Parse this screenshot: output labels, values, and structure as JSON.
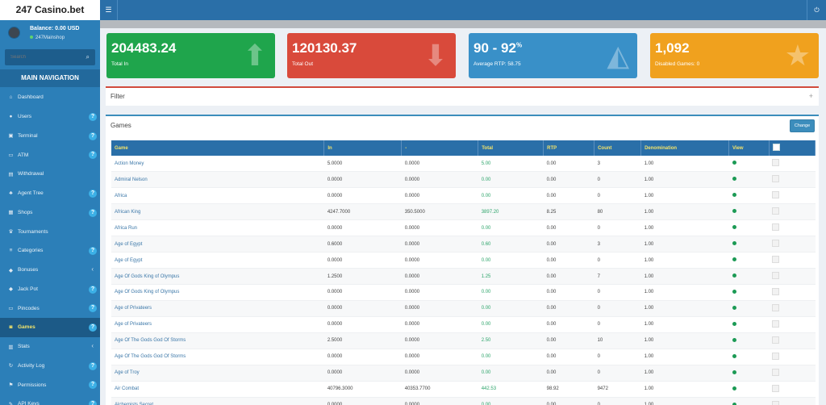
{
  "app": {
    "title": "247 Casino.bet"
  },
  "user": {
    "balance": "Balance: 0.00 USD",
    "shop": "247Mainshop"
  },
  "search": {
    "placeholder": "Search"
  },
  "nav": {
    "heading": "MAIN NAVIGATION",
    "items": [
      {
        "label": "Dashboard",
        "icon": "home-icon",
        "glyph": "⌂",
        "badge": ""
      },
      {
        "label": "Users",
        "icon": "user-icon",
        "glyph": "●",
        "badge": "?"
      },
      {
        "label": "Terminal",
        "icon": "terminal-icon",
        "glyph": "▣",
        "badge": "?"
      },
      {
        "label": "ATM",
        "icon": "credit-card-icon",
        "glyph": "▭",
        "badge": "?"
      },
      {
        "label": "Withdrawal",
        "icon": "money-icon",
        "glyph": "▤",
        "badge": ""
      },
      {
        "label": "Agent Tree",
        "icon": "sitemap-icon",
        "glyph": "♣",
        "badge": "?"
      },
      {
        "label": "Shops",
        "icon": "shop-icon",
        "glyph": "▦",
        "badge": "?"
      },
      {
        "label": "Tournaments",
        "icon": "trophy-icon",
        "glyph": "♛",
        "badge": ""
      },
      {
        "label": "Categories",
        "icon": "list-icon",
        "glyph": "≡",
        "badge": "?"
      },
      {
        "label": "Bonuses",
        "icon": "diamond-icon",
        "glyph": "◆",
        "badge": "‹"
      },
      {
        "label": "Jack Pot",
        "icon": "diamond-icon",
        "glyph": "◆",
        "badge": "?"
      },
      {
        "label": "Pincodes",
        "icon": "key-icon",
        "glyph": "▭",
        "badge": "?"
      },
      {
        "label": "Games",
        "icon": "gamepad-icon",
        "glyph": "◙",
        "badge": "?"
      },
      {
        "label": "Stats",
        "icon": "chart-icon",
        "glyph": "▥",
        "badge": "‹"
      },
      {
        "label": "Activity Log",
        "icon": "history-icon",
        "glyph": "↻",
        "badge": "?"
      },
      {
        "label": "Permissions",
        "icon": "shield-icon",
        "glyph": "⚑",
        "badge": "?"
      },
      {
        "label": "API Keys",
        "icon": "key-icon",
        "glyph": "✎",
        "badge": "?"
      }
    ]
  },
  "stats": [
    {
      "value": "204483.24",
      "label": "Total In",
      "icon": "arrow-up-icon",
      "glyph": "⬆"
    },
    {
      "value": "120130.37",
      "label": "Total Out",
      "icon": "arrow-down-icon",
      "glyph": "⬇"
    },
    {
      "value": "90 - 92",
      "suffix": "%",
      "label": "Average RTP: 58.75",
      "icon": "area-chart-icon",
      "glyph": "◭"
    },
    {
      "value": "1,092",
      "label": "Disabled Games: 0",
      "icon": "star-icon",
      "glyph": "★"
    }
  ],
  "filter": {
    "title": "Filter",
    "toggle": "+"
  },
  "games": {
    "title": "Games",
    "change_label": "Change",
    "columns": [
      "Game",
      "In",
      "-",
      "Total",
      "RTP",
      "Count",
      "Denomination",
      "View"
    ],
    "rows": [
      [
        "Action Money",
        "5.0000",
        "0.0000",
        "5.00",
        "0.00",
        "3",
        "1.00"
      ],
      [
        "Admiral Nelson",
        "0.0000",
        "0.0000",
        "0.00",
        "0.00",
        "0",
        "1.00"
      ],
      [
        "Africa",
        "0.0000",
        "0.0000",
        "0.00",
        "0.00",
        "0",
        "1.00"
      ],
      [
        "African King",
        "4247.7000",
        "350.5000",
        "3897.20",
        "8.25",
        "80",
        "1.00"
      ],
      [
        "Africa Run",
        "0.0000",
        "0.0000",
        "0.00",
        "0.00",
        "0",
        "1.00"
      ],
      [
        "Age of Egypt",
        "0.6000",
        "0.0000",
        "0.60",
        "0.00",
        "3",
        "1.00"
      ],
      [
        "Age of Egypt",
        "0.0000",
        "0.0000",
        "0.00",
        "0.00",
        "0",
        "1.00"
      ],
      [
        "Age Of Gods King of Olympus",
        "1.2500",
        "0.0000",
        "1.25",
        "0.00",
        "7",
        "1.00"
      ],
      [
        "Age Of Gods King of Olympus",
        "0.0000",
        "0.0000",
        "0.00",
        "0.00",
        "0",
        "1.00"
      ],
      [
        "Age of Privateers",
        "0.0000",
        "0.0000",
        "0.00",
        "0.00",
        "0",
        "1.00"
      ],
      [
        "Age of Privateers",
        "0.0000",
        "0.0000",
        "0.00",
        "0.00",
        "0",
        "1.00"
      ],
      [
        "Age Of The Gods God Of Storms",
        "2.5000",
        "0.0000",
        "2.50",
        "0.00",
        "10",
        "1.00"
      ],
      [
        "Age Of The Gods God Of Storms",
        "0.0000",
        "0.0000",
        "0.00",
        "0.00",
        "0",
        "1.00"
      ],
      [
        "Age of Troy",
        "0.0000",
        "0.0000",
        "0.00",
        "0.00",
        "0",
        "1.00"
      ],
      [
        "Air Combat",
        "40796.3000",
        "40353.7700",
        "442.53",
        "98.92",
        "9472",
        "1.00"
      ],
      [
        "Alchemists Secret",
        "0.0000",
        "0.0000",
        "0.00",
        "0.00",
        "0",
        "1.00"
      ]
    ]
  }
}
